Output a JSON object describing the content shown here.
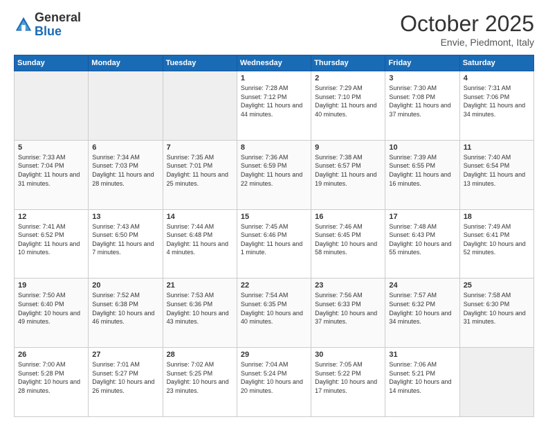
{
  "header": {
    "logo_general": "General",
    "logo_blue": "Blue",
    "title": "October 2025",
    "subtitle": "Envie, Piedmont, Italy"
  },
  "weekdays": [
    "Sunday",
    "Monday",
    "Tuesday",
    "Wednesday",
    "Thursday",
    "Friday",
    "Saturday"
  ],
  "weeks": [
    [
      {
        "day": "",
        "empty": true
      },
      {
        "day": "",
        "empty": true
      },
      {
        "day": "",
        "empty": true
      },
      {
        "day": "1",
        "sunrise": "7:28 AM",
        "sunset": "7:12 PM",
        "daylight": "11 hours and 44 minutes."
      },
      {
        "day": "2",
        "sunrise": "7:29 AM",
        "sunset": "7:10 PM",
        "daylight": "11 hours and 40 minutes."
      },
      {
        "day": "3",
        "sunrise": "7:30 AM",
        "sunset": "7:08 PM",
        "daylight": "11 hours and 37 minutes."
      },
      {
        "day": "4",
        "sunrise": "7:31 AM",
        "sunset": "7:06 PM",
        "daylight": "11 hours and 34 minutes."
      }
    ],
    [
      {
        "day": "5",
        "sunrise": "7:33 AM",
        "sunset": "7:04 PM",
        "daylight": "11 hours and 31 minutes."
      },
      {
        "day": "6",
        "sunrise": "7:34 AM",
        "sunset": "7:03 PM",
        "daylight": "11 hours and 28 minutes."
      },
      {
        "day": "7",
        "sunrise": "7:35 AM",
        "sunset": "7:01 PM",
        "daylight": "11 hours and 25 minutes."
      },
      {
        "day": "8",
        "sunrise": "7:36 AM",
        "sunset": "6:59 PM",
        "daylight": "11 hours and 22 minutes."
      },
      {
        "day": "9",
        "sunrise": "7:38 AM",
        "sunset": "6:57 PM",
        "daylight": "11 hours and 19 minutes."
      },
      {
        "day": "10",
        "sunrise": "7:39 AM",
        "sunset": "6:55 PM",
        "daylight": "11 hours and 16 minutes."
      },
      {
        "day": "11",
        "sunrise": "7:40 AM",
        "sunset": "6:54 PM",
        "daylight": "11 hours and 13 minutes."
      }
    ],
    [
      {
        "day": "12",
        "sunrise": "7:41 AM",
        "sunset": "6:52 PM",
        "daylight": "11 hours and 10 minutes."
      },
      {
        "day": "13",
        "sunrise": "7:43 AM",
        "sunset": "6:50 PM",
        "daylight": "11 hours and 7 minutes."
      },
      {
        "day": "14",
        "sunrise": "7:44 AM",
        "sunset": "6:48 PM",
        "daylight": "11 hours and 4 minutes."
      },
      {
        "day": "15",
        "sunrise": "7:45 AM",
        "sunset": "6:46 PM",
        "daylight": "11 hours and 1 minute."
      },
      {
        "day": "16",
        "sunrise": "7:46 AM",
        "sunset": "6:45 PM",
        "daylight": "10 hours and 58 minutes."
      },
      {
        "day": "17",
        "sunrise": "7:48 AM",
        "sunset": "6:43 PM",
        "daylight": "10 hours and 55 minutes."
      },
      {
        "day": "18",
        "sunrise": "7:49 AM",
        "sunset": "6:41 PM",
        "daylight": "10 hours and 52 minutes."
      }
    ],
    [
      {
        "day": "19",
        "sunrise": "7:50 AM",
        "sunset": "6:40 PM",
        "daylight": "10 hours and 49 minutes."
      },
      {
        "day": "20",
        "sunrise": "7:52 AM",
        "sunset": "6:38 PM",
        "daylight": "10 hours and 46 minutes."
      },
      {
        "day": "21",
        "sunrise": "7:53 AM",
        "sunset": "6:36 PM",
        "daylight": "10 hours and 43 minutes."
      },
      {
        "day": "22",
        "sunrise": "7:54 AM",
        "sunset": "6:35 PM",
        "daylight": "10 hours and 40 minutes."
      },
      {
        "day": "23",
        "sunrise": "7:56 AM",
        "sunset": "6:33 PM",
        "daylight": "10 hours and 37 minutes."
      },
      {
        "day": "24",
        "sunrise": "7:57 AM",
        "sunset": "6:32 PM",
        "daylight": "10 hours and 34 minutes."
      },
      {
        "day": "25",
        "sunrise": "7:58 AM",
        "sunset": "6:30 PM",
        "daylight": "10 hours and 31 minutes."
      }
    ],
    [
      {
        "day": "26",
        "sunrise": "7:00 AM",
        "sunset": "5:28 PM",
        "daylight": "10 hours and 28 minutes."
      },
      {
        "day": "27",
        "sunrise": "7:01 AM",
        "sunset": "5:27 PM",
        "daylight": "10 hours and 26 minutes."
      },
      {
        "day": "28",
        "sunrise": "7:02 AM",
        "sunset": "5:25 PM",
        "daylight": "10 hours and 23 minutes."
      },
      {
        "day": "29",
        "sunrise": "7:04 AM",
        "sunset": "5:24 PM",
        "daylight": "10 hours and 20 minutes."
      },
      {
        "day": "30",
        "sunrise": "7:05 AM",
        "sunset": "5:22 PM",
        "daylight": "10 hours and 17 minutes."
      },
      {
        "day": "31",
        "sunrise": "7:06 AM",
        "sunset": "5:21 PM",
        "daylight": "10 hours and 14 minutes."
      },
      {
        "day": "",
        "empty": true
      }
    ]
  ]
}
